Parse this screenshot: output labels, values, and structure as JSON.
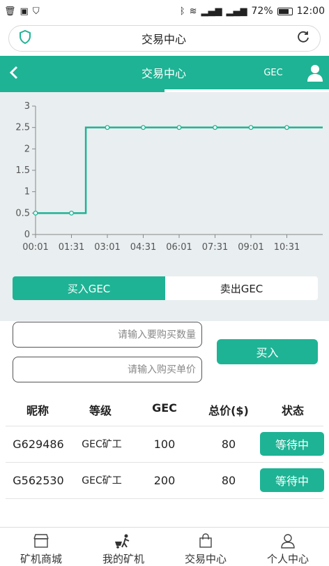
{
  "status_bar": {
    "battery": "72%",
    "time": "12:00"
  },
  "browser": {
    "title": "交易中心"
  },
  "header": {
    "title": "交易中心",
    "coin": "GEC"
  },
  "chart_data": {
    "type": "line",
    "x": [
      "00:01",
      "01:31",
      "03:01",
      "04:31",
      "06:01",
      "07:31",
      "09:01",
      "10:31"
    ],
    "series": [
      {
        "values": [
          0.5,
          0.5,
          2.5,
          2.5,
          2.5,
          2.5,
          2.5,
          2.5
        ]
      }
    ],
    "y_ticks": [
      "0",
      "0.5",
      "1",
      "1.5",
      "2",
      "2.5",
      "3"
    ],
    "ylim": [
      0,
      3
    ],
    "line_color": "#1eb394",
    "grid": false
  },
  "trade_tabs": {
    "buy": "买入GEC",
    "sell": "卖出GEC"
  },
  "form": {
    "quantity_placeholder": "请输入要购买数量",
    "price_placeholder": "请输入购买单价",
    "buy_label": "买入"
  },
  "table": {
    "headers": [
      "昵称",
      "等级",
      "GEC",
      "总价($)",
      "状态"
    ],
    "rows": [
      {
        "nickname": "G629486",
        "level": "GEC矿工",
        "gec": "100",
        "total": "80",
        "status": "等待中"
      },
      {
        "nickname": "G562530",
        "level": "GEC矿工",
        "gec": "200",
        "total": "80",
        "status": "等待中"
      }
    ]
  },
  "bottom_nav": [
    {
      "label": "矿机商城",
      "icon": "shop-icon"
    },
    {
      "label": "我的矿机",
      "icon": "miner-icon"
    },
    {
      "label": "交易中心",
      "icon": "bag-icon"
    },
    {
      "label": "个人中心",
      "icon": "person-icon"
    }
  ],
  "colors": {
    "accent": "#1eb394",
    "chart_bg": "#e9eef0"
  }
}
